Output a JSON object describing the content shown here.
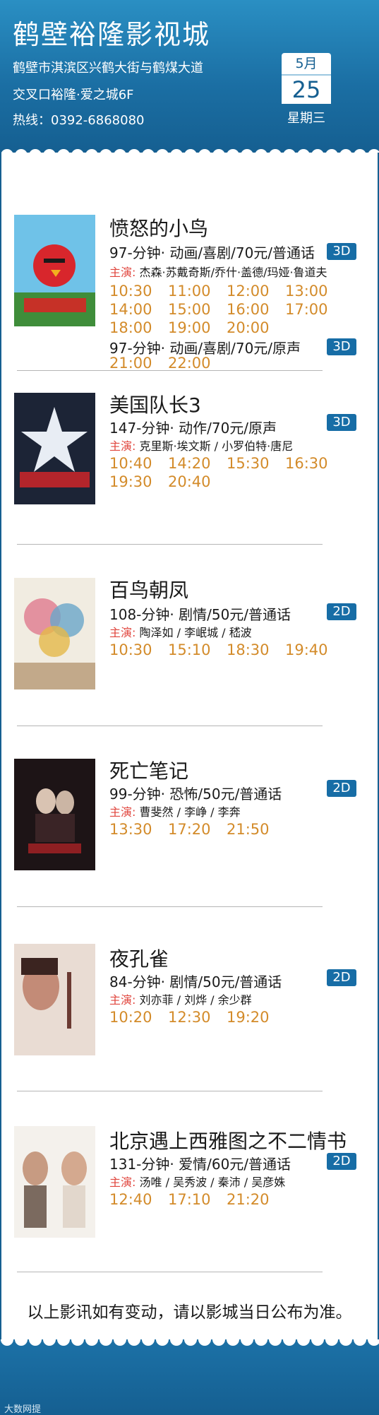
{
  "header": {
    "cinema_name": "鹤壁裕隆影视城",
    "address_line1": "鹤壁市淇滨区兴鹤大街与鹤煤大道",
    "address_line2": "交叉口裕隆·爱之城6F",
    "hotline": "热线：0392-6868080",
    "date_month": "5月",
    "date_day": "25",
    "weekday": "星期三"
  },
  "colors": {
    "brand_blue": "#155f91",
    "time_orange": "#d38b2a",
    "cast_label_red": "#e0453d"
  },
  "movies": [
    {
      "title": "愤怒的小鸟",
      "poster_icon": "angry-birds-poster",
      "info1": "97-分钟· 动画/喜剧/70元/普通话",
      "format1": "3D",
      "cast_label": "主演:",
      "cast": "杰森·苏戴奇斯/乔什·盖德/玛娅·鲁道夫",
      "times1": [
        "10:30",
        "11:00",
        "12:00",
        "13:00",
        "14:00",
        "15:00",
        "16:00",
        "17:00",
        "18:00",
        "19:00",
        "20:00"
      ],
      "info2": "97-分钟· 动画/喜剧/70元/原声",
      "format2": "3D",
      "times2": [
        "21:00",
        "22:00"
      ]
    },
    {
      "title": "美国队长3",
      "poster_icon": "captain-america-poster",
      "info1": "147-分钟· 动作/70元/原声",
      "format1": "3D",
      "cast_label": "主演:",
      "cast": "克里斯·埃文斯 / 小罗伯特·唐尼",
      "times1": [
        "10:40",
        "14:20",
        "15:30",
        "16:30",
        "19:30",
        "20:40"
      ]
    },
    {
      "title": "百鸟朝凤",
      "poster_icon": "bainiaochaofeng-poster",
      "info1": "108-分钟· 剧情/50元/普通话",
      "format1": "2D",
      "cast_label": "主演:",
      "cast": "陶泽如 / 李岷城 / 嵇波",
      "times1": [
        "10:30",
        "15:10",
        "18:30",
        "19:40"
      ]
    },
    {
      "title": "死亡笔记",
      "poster_icon": "death-note-poster",
      "info1": "99-分钟· 恐怖/50元/普通话",
      "format1": "2D",
      "cast_label": "主演:",
      "cast": "曹斐然 / 李峥 / 李奔",
      "times1": [
        "13:30",
        "17:20",
        "21:50"
      ]
    },
    {
      "title": "夜孔雀",
      "poster_icon": "night-peacock-poster",
      "info1": "84-分钟· 剧情/50元/普通话",
      "format1": "2D",
      "cast_label": "主演:",
      "cast": "刘亦菲 / 刘烨 / 余少群",
      "times1": [
        "10:20",
        "12:30",
        "19:20"
      ]
    },
    {
      "title": "北京遇上西雅图之不二情书",
      "poster_icon": "book-of-love-poster",
      "info1": "131-分钟· 爱情/60元/普通话",
      "format1": "2D",
      "cast_label": "主演:",
      "cast": "汤唯 / 吴秀波 / 秦沛 / 吴彦姝",
      "times1": [
        "12:40",
        "17:10",
        "21:20"
      ]
    }
  ],
  "notice": "以上影讯如有变动，请以影城当日公布为准。",
  "watermark": "大数网提"
}
